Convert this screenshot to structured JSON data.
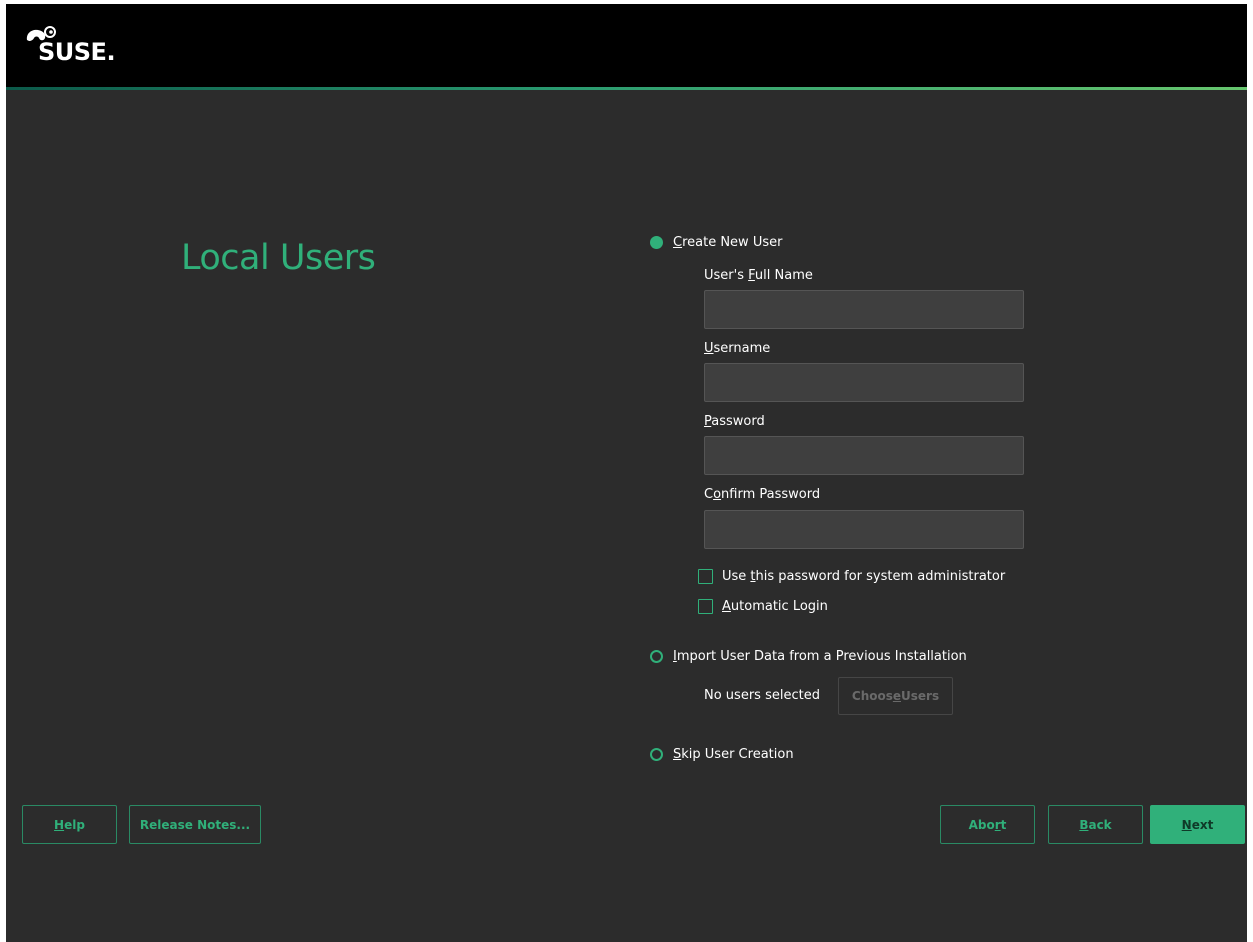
{
  "header": {
    "logo_text": "SUSE."
  },
  "page": {
    "title": "Local Users"
  },
  "options": {
    "create_new_user": {
      "label_pre": "",
      "label_accel": "C",
      "label_post": "reate New User",
      "selected": true
    },
    "import_user_data": {
      "label_pre": "",
      "label_accel": "I",
      "label_post": "mport User Data from a Previous Installation",
      "selected": false
    },
    "skip_user_creation": {
      "label_pre": "",
      "label_accel": "S",
      "label_post": "kip User Creation",
      "selected": false
    }
  },
  "form": {
    "full_name": {
      "label_pre": "User's ",
      "label_accel": "F",
      "label_post": "ull Name",
      "value": ""
    },
    "username": {
      "label_pre": "",
      "label_accel": "U",
      "label_post": "sername",
      "value": ""
    },
    "password": {
      "label_pre": "",
      "label_accel": "P",
      "label_post": "assword",
      "value": ""
    },
    "confirm_password": {
      "label_pre": "C",
      "label_accel": "o",
      "label_post": "nfirm Password",
      "value": ""
    },
    "use_password_for_admin": {
      "label_pre": "Use ",
      "label_accel": "t",
      "label_post": "his password for system administrator",
      "checked": false
    },
    "automatic_login": {
      "label_pre": "",
      "label_accel": "A",
      "label_post": "utomatic Login",
      "checked": false
    }
  },
  "import": {
    "status": "No users selected",
    "choose_button": {
      "label_pre": "Choos",
      "label_accel": "e",
      "label_post": " Users",
      "enabled": false
    }
  },
  "footer": {
    "help": {
      "pre": "",
      "accel": "H",
      "post": "elp"
    },
    "release_notes": {
      "pre": "Release Notes...",
      "accel": "",
      "post": ""
    },
    "abort": {
      "pre": "Abo",
      "accel": "r",
      "post": "t"
    },
    "back": {
      "pre": "",
      "accel": "B",
      "post": "ack"
    },
    "next": {
      "pre": "",
      "accel": "N",
      "post": "ext"
    }
  },
  "colors": {
    "accent": "#30b07a",
    "background": "#2c2c2c",
    "header": "#000000",
    "input_bg": "#3f3f3f"
  }
}
